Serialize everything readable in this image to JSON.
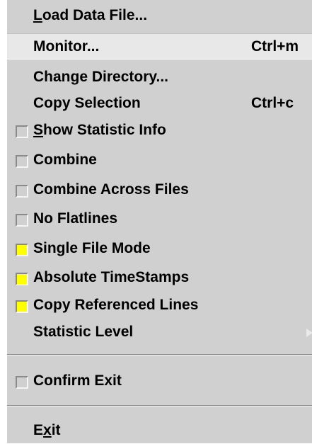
{
  "menu": {
    "load": {
      "pre": "",
      "mnemonic": "L",
      "post": "oad Data File..."
    },
    "monitor": {
      "label": "Monitor...",
      "shortcut": "Ctrl+m"
    },
    "change_dir": {
      "label": "Change Directory..."
    },
    "copy_selection": {
      "label": "Copy Selection",
      "shortcut": "Ctrl+c"
    },
    "show_stat": {
      "pre": "",
      "mnemonic": "S",
      "post": "how Statistic Info",
      "checked": false
    },
    "combine": {
      "label": "Combine",
      "checked": false
    },
    "combine_across": {
      "label": "Combine Across Files",
      "checked": false
    },
    "no_flatlines": {
      "label": "No Flatlines",
      "checked": false
    },
    "single_file": {
      "label": "Single File Mode",
      "checked": true
    },
    "absolute_ts": {
      "label": "Absolute TimeStamps",
      "checked": true
    },
    "copy_ref": {
      "label": "Copy Referenced Lines",
      "checked": true
    },
    "stat_level": {
      "label": "Statistic Level",
      "icon": "submenu-arrow-icon"
    },
    "confirm_exit": {
      "label": "Confirm Exit",
      "checked": false
    },
    "exit": {
      "pre": "E",
      "mnemonic": "x",
      "post": "it"
    }
  },
  "colors": {
    "menu_bg": "#d0d0d0",
    "highlight_bg": "#e8e8e8",
    "check_on": "#ffff00"
  }
}
